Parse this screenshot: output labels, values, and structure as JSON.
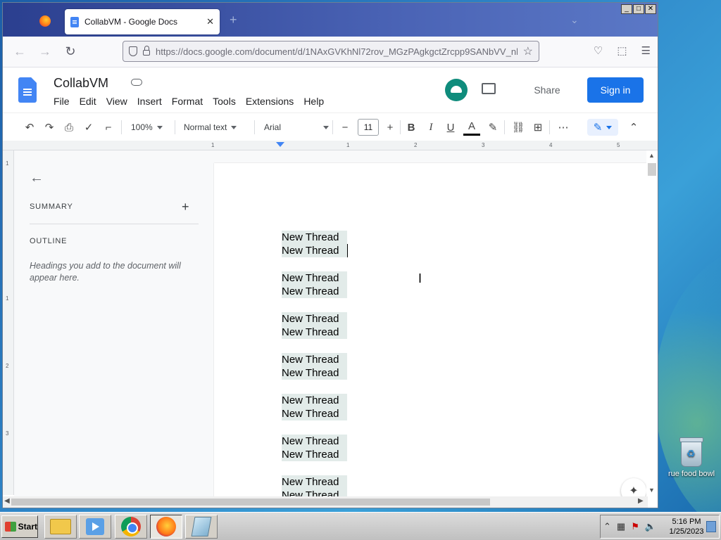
{
  "browser": {
    "tab_title": "CollabVM - Google Docs",
    "tab_close": "✕",
    "new_tab": "+",
    "url": "https://docs.google.com/document/d/1NAxGVKhNl72rov_MGzPAgkgctZrcpp9SANbVV_nl",
    "window_buttons": [
      "_",
      "□",
      "✕"
    ]
  },
  "docs": {
    "title": "CollabVM",
    "menu": [
      "File",
      "Edit",
      "View",
      "Insert",
      "Format",
      "Tools",
      "Extensions",
      "Help"
    ],
    "share_label": "Share",
    "signin_label": "Sign in"
  },
  "toolbar": {
    "zoom": "100%",
    "style": "Normal text",
    "font": "Arial",
    "font_size": "11",
    "bold": "B",
    "italic": "I",
    "underline": "U",
    "text_color": "A",
    "more": "⋯"
  },
  "ruler": {
    "h_ticks": [
      "1",
      "1",
      "2",
      "3",
      "4",
      "5"
    ],
    "v_ticks": [
      "1",
      "1",
      "2",
      "3"
    ]
  },
  "sidebar": {
    "summary_label": "SUMMARY",
    "outline_label": "OUTLINE",
    "outline_help": "Headings you add to the document will appear here."
  },
  "document": {
    "lines": [
      "New Thread",
      "New Thread",
      "New Thread",
      "New Thread",
      "New Thread",
      "New Thread",
      "New Thread",
      "New Thread",
      "New Thread",
      "New Thread",
      "New Thread",
      "New Thread",
      "New Thread",
      "New Thread"
    ]
  },
  "desktop": {
    "recycle_label": "rue food bowl"
  },
  "taskbar": {
    "start_label": "Start",
    "time": "5:16 PM",
    "date": "1/25/2023"
  },
  "colors": {
    "accent": "#1a73e8",
    "docs_blue": "#4285f4",
    "selection": "#e2ebe9"
  }
}
